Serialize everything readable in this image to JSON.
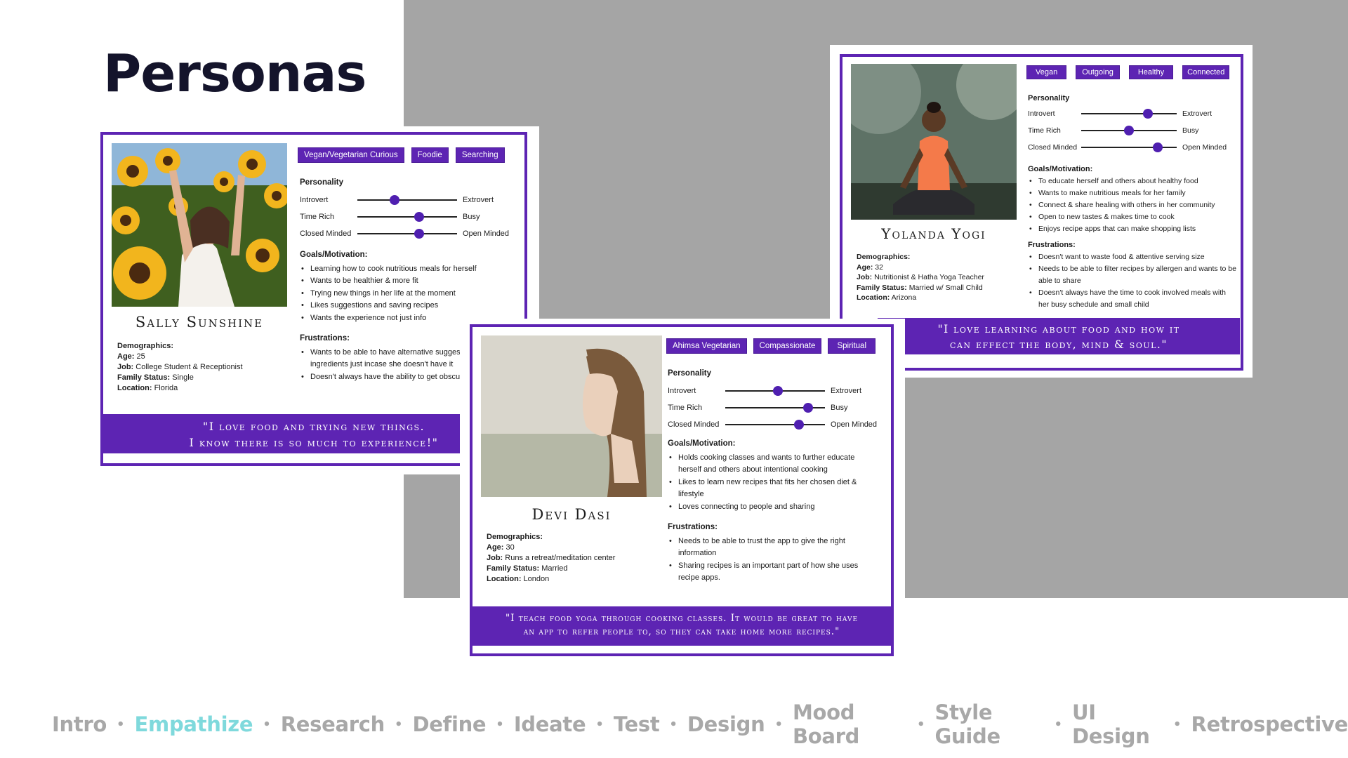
{
  "slide": {
    "title": "Personas"
  },
  "colors": {
    "accent_purple": "#5d24b3",
    "nav_gray": "#a8a8a8",
    "nav_active": "#7fd9dc",
    "backdrop_gray": "#a5a5a5"
  },
  "personas": {
    "sally": {
      "name": "Sally Sunshine",
      "tags": [
        "Vegan/Vegetarian Curious",
        "Foodie",
        "Searching"
      ],
      "personality_heading": "Personality",
      "traits": [
        {
          "left": "Introvert",
          "right": "Extrovert",
          "level": 0.37
        },
        {
          "left": "Time Rich",
          "right": "Busy",
          "level": 0.62
        },
        {
          "left": "Closed Minded",
          "right": "Open Minded",
          "level": 0.62
        }
      ],
      "goals_heading": "Goals/Motivation:",
      "goals": [
        "Learning how to cook nutritious meals for herself",
        "Wants to be healthier & more fit",
        "Trying new things in her life at the moment",
        "Likes suggestions and saving recipes",
        "Wants the experience not just info"
      ],
      "frustrations_heading": "Frustrations:",
      "frustrations": [
        "Wants to be able to have alternative suggestions for ingredients just incase she doesn't have it",
        "Doesn't always have the ability to get obscure ingredients"
      ],
      "demographics_heading": "Demographics:",
      "demographics": {
        "age_label": "Age:",
        "age": "25",
        "job_label": "Job:",
        "job": "College Student & Receptionist",
        "family_label": "Family Status:",
        "family": "Single",
        "location_label": "Location:",
        "location": "Florida"
      },
      "quote_line1": "\"I love food and trying new things.",
      "quote_line2": "I know there is so much to experience!\""
    },
    "yolanda": {
      "name": "Yolanda Yogi",
      "tags": [
        "Vegan",
        "Outgoing",
        "Healthy",
        "Connected"
      ],
      "personality_heading": "Personality",
      "traits": [
        {
          "left": "Introvert",
          "right": "Extrovert",
          "level": 0.7
        },
        {
          "left": "Time Rich",
          "right": "Busy",
          "level": 0.5
        },
        {
          "left": "Closed Minded",
          "right": "Open Minded",
          "level": 0.8
        }
      ],
      "goals_heading": "Goals/Motivation:",
      "goals": [
        "To educate herself and others about healthy food",
        "Wants to make nutritious meals for her family",
        "Connect & share healing with others in her community",
        "Open to new tastes & makes time to cook",
        "Enjoys recipe apps that can make shopping lists"
      ],
      "frustrations_heading": "Frustrations:",
      "frustrations": [
        "Doesn't want to waste food & attentive serving size",
        "Needs to be able to filter recipes by allergen and wants to be able to share",
        "Doesn't always have the time to cook involved meals with her busy schedule and small child"
      ],
      "demographics_heading": "Demographics:",
      "demographics": {
        "age_label": "Age:",
        "age": "32",
        "job_label": "Job:",
        "job": "Nutritionist & Hatha Yoga Teacher",
        "family_label": "Family Status:",
        "family": "Married w/ Small Child",
        "location_label": "Location:",
        "location": "Arizona"
      },
      "quote_line1": "\"I love learning about food and how it",
      "quote_line2": "can effect the body, mind & soul.\""
    },
    "devi": {
      "name": "Devi Dasi",
      "tags": [
        "Ahimsa Vegetarian",
        "Compassionate",
        "Spiritual"
      ],
      "personality_heading": "Personality",
      "traits": [
        {
          "left": "Introvert",
          "right": "Extrovert",
          "level": 0.53
        },
        {
          "left": "Time Rich",
          "right": "Busy",
          "level": 0.83
        },
        {
          "left": "Closed Minded",
          "right": "Open Minded",
          "level": 0.74
        }
      ],
      "goals_heading": "Goals/Motivation:",
      "goals": [
        "Holds cooking classes and wants to further educate herself and others about intentional cooking",
        "Likes to learn new recipes that fits her chosen diet & lifestyle",
        "Loves connecting to people and sharing"
      ],
      "frustrations_heading": "Frustrations:",
      "frustrations": [
        "Needs to be able to trust the app to give the right information",
        "Sharing recipes is an important part of how she uses recipe apps."
      ],
      "demographics_heading": "Demographics:",
      "demographics": {
        "age_label": "Age:",
        "age": "30",
        "job_label": "Job:",
        "job": "Runs a retreat/meditation center",
        "family_label": "Family Status:",
        "family": "Married",
        "location_label": "Location:",
        "location": "London"
      },
      "quote_line1": "\"I teach food yoga through cooking classes. It would be great to have",
      "quote_line2": "an app to refer people to, so they can take home more recipes.\""
    }
  },
  "nav": {
    "items": [
      "Intro",
      "Empathize",
      "Research",
      "Define",
      "Ideate",
      "Test",
      "Design",
      "Mood Board",
      "Style Guide",
      "UI Design",
      "Retrospective"
    ],
    "active": "Empathize",
    "separator": "•"
  }
}
